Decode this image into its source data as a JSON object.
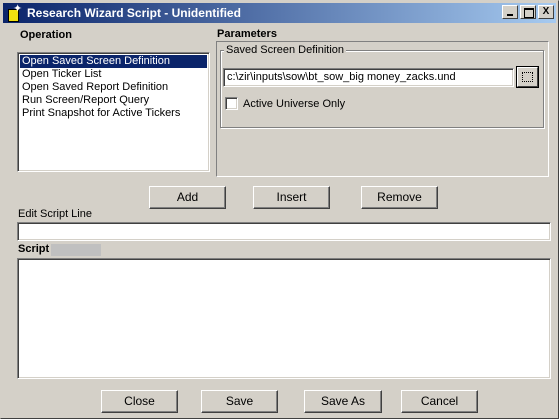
{
  "window": {
    "title": "Research Wizard Script - Unidentified",
    "controls": {
      "minimize": "_",
      "maximize": "□",
      "close": "X"
    }
  },
  "operation": {
    "label": "Operation",
    "items": [
      {
        "label": "Open Saved Screen Definition",
        "selected": true
      },
      {
        "label": "Open Ticker List",
        "selected": false
      },
      {
        "label": "Open Saved Report Definition",
        "selected": false
      },
      {
        "label": "Run Screen/Report Query",
        "selected": false
      },
      {
        "label": "Print Snapshot for Active Tickers",
        "selected": false
      }
    ]
  },
  "parameters": {
    "label": "Parameters",
    "group_label": "Saved Screen Definition",
    "path_value": "c:\\zir\\inputs\\sow\\bt_sow_big money_zacks.und",
    "active_universe_label": "Active Universe Only",
    "active_universe_checked": false
  },
  "actions": {
    "add": "Add",
    "insert": "Insert",
    "remove": "Remove"
  },
  "edit_script": {
    "label": "Edit Script Line",
    "value": ""
  },
  "script": {
    "label": "Script"
  },
  "footer": {
    "close": "Close",
    "save": "Save",
    "save_as": "Save As",
    "cancel": "Cancel"
  },
  "icons": {
    "app": "wizard-wand-icon",
    "browse": "browse-icon"
  }
}
